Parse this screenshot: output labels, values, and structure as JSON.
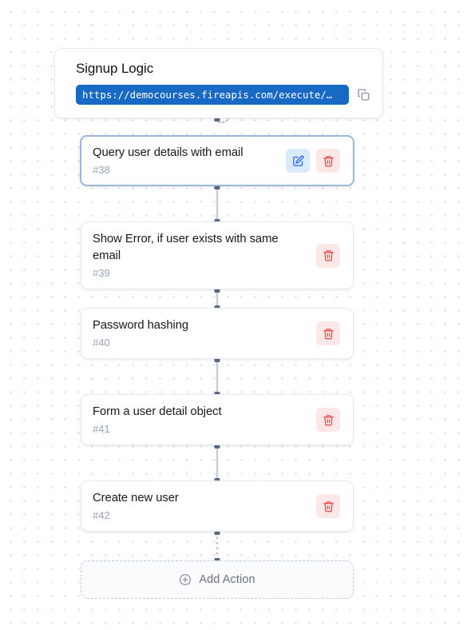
{
  "header": {
    "title": "Signup Logic",
    "url": "https://democourses.fireapis.com/execute/…",
    "copy_icon": "copy-icon"
  },
  "actions": [
    {
      "title": "Query user details with email",
      "id": "#38",
      "selected": true,
      "has_edit": true,
      "has_delete": true,
      "edit_icon": "pencil-square-icon",
      "delete_icon": "trash-icon"
    },
    {
      "title": "Show Error, if user exists with same email",
      "id": "#39",
      "selected": false,
      "has_edit": false,
      "has_delete": true,
      "delete_icon": "trash-icon"
    },
    {
      "title": "Password hashing",
      "id": "#40",
      "selected": false,
      "has_edit": false,
      "has_delete": true,
      "delete_icon": "trash-icon"
    },
    {
      "title": "Form a user detail object",
      "id": "#41",
      "selected": false,
      "has_edit": false,
      "has_delete": true,
      "delete_icon": "trash-icon"
    },
    {
      "title": "Create new user",
      "id": "#42",
      "selected": false,
      "has_edit": false,
      "has_delete": true,
      "delete_icon": "trash-icon"
    }
  ],
  "add_action": {
    "label": "Add Action",
    "icon": "plus-circle-icon"
  },
  "colors": {
    "url_pill": "#1769c4",
    "edit_accent": "#2563eb",
    "edit_bg": "#dbeafe",
    "delete_accent": "#ef4444",
    "delete_bg": "#fde8e8",
    "connector": "#c8ccd4",
    "handle": "#5a6b85",
    "selected_border": "#9eb6d8",
    "canvas_dot": "#d4d7de"
  },
  "layout": {
    "card_tops": [
      169,
      277,
      385,
      493,
      601
    ],
    "card_heights": [
      64,
      85,
      64,
      64,
      64
    ]
  }
}
